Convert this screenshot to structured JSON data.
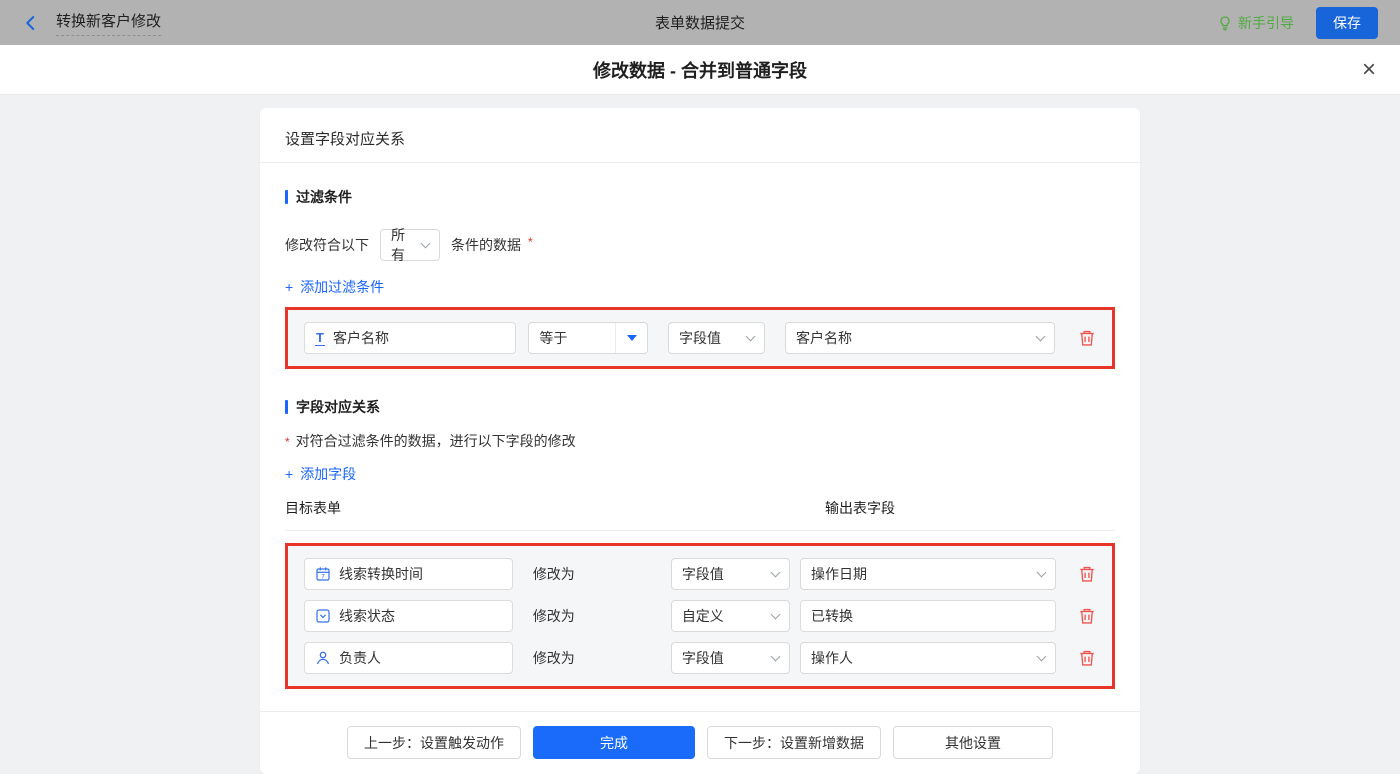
{
  "colors": {
    "topbar_bg": "#b2b2b2",
    "accent_blue": "#1a66ff",
    "save_blue": "#1765d9",
    "finish_blue": "#1a6bfa",
    "guide_green": "#52aa43",
    "highlight_red_border": "#e8352a",
    "trash_red": "#f0544f",
    "row_bg": "#f5f6f7"
  },
  "icons": [
    "back-icon",
    "lightbulb-icon",
    "close-icon",
    "plus-icon",
    "chevron-down-icon",
    "caret-down-icon",
    "text-icon",
    "calendar-icon",
    "select-field-icon",
    "person-icon",
    "trash-icon"
  ],
  "topbar": {
    "flow_name": "转换新客户修改",
    "center_title": "表单数据提交",
    "guide_label": "新手引导",
    "save_label": "保存"
  },
  "modal": {
    "title": "修改数据 - 合并到普通字段",
    "close_glyph": "×",
    "card_title": "设置字段对应关系",
    "plus": "+",
    "filter_section": {
      "title": "过滤条件",
      "sentence_prefix": "修改符合以下",
      "match_select_value": "所有",
      "sentence_suffix": "条件的数据",
      "required_mark": "*",
      "add_link_label": "添加过滤条件",
      "condition": {
        "field": "客户名称",
        "field_icon_glyph": "T",
        "operator": "等于",
        "value_type": "字段值",
        "value": "客户名称"
      }
    },
    "mapping_section": {
      "title": "字段对应关系",
      "required_mark": "*",
      "description": "对符合过滤条件的数据，进行以下字段的修改",
      "add_link_label": "添加字段",
      "col_target": "目标表单",
      "col_output": "输出表字段",
      "modify_label": "修改为",
      "rows": [
        {
          "target": "线索转换时间",
          "icon": "calendar-icon",
          "type": "字段值",
          "value": "操作日期",
          "value_kind": "select"
        },
        {
          "target": "线索状态",
          "icon": "select-field-icon",
          "type": "自定义",
          "value": "已转换",
          "value_kind": "input"
        },
        {
          "target": "负责人",
          "icon": "person-icon",
          "type": "字段值",
          "value": "操作人",
          "value_kind": "select"
        }
      ]
    },
    "footer": {
      "prev_label": "上一步：设置触发动作",
      "finish_label": "完成",
      "next_label": "下一步：设置新增数据",
      "other_label": "其他设置"
    }
  }
}
